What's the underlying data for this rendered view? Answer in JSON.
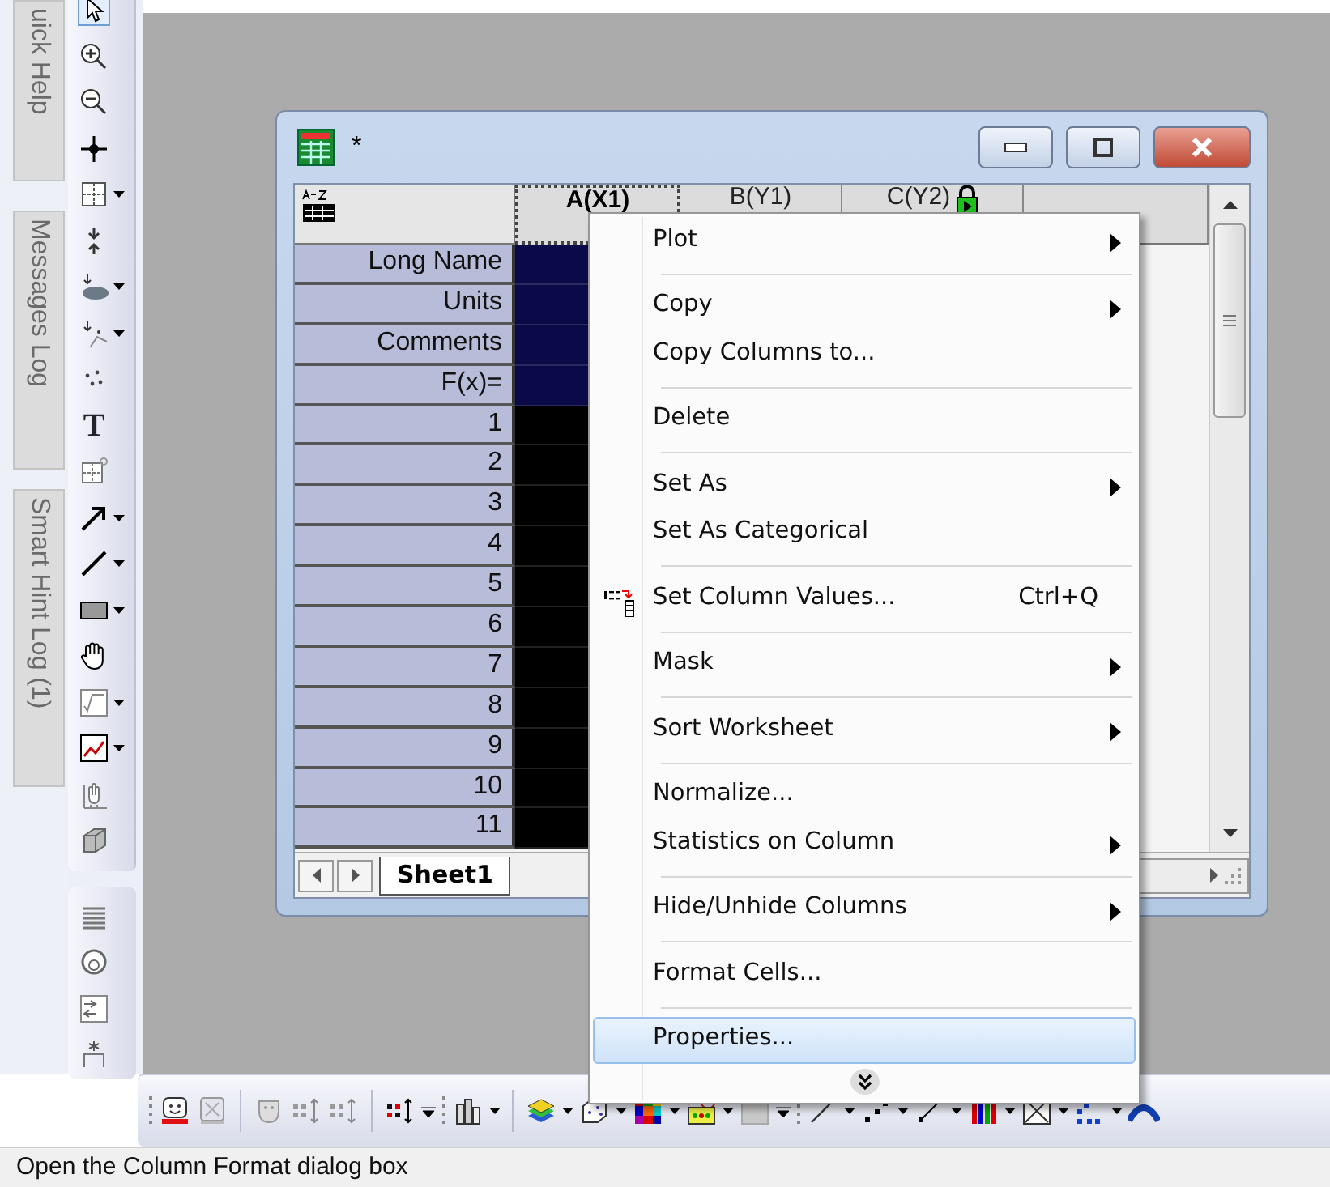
{
  "side_panels": [
    {
      "label": "uick Help"
    },
    {
      "label": "Messages Log"
    },
    {
      "label": "Smart Hint Log (1)"
    }
  ],
  "left_toolbar": {
    "text_tool": "T"
  },
  "worksheet": {
    "title": "*",
    "columns": [
      {
        "label": "A(X1)",
        "selected": true,
        "locked": false
      },
      {
        "label": "B(Y1)",
        "selected": false,
        "locked": false
      },
      {
        "label": "C(Y2)",
        "selected": false,
        "locked": true
      }
    ],
    "row_labels": [
      "Long Name",
      "Units",
      "Comments",
      "F(x)=",
      "1",
      "2",
      "3",
      "4",
      "5",
      "6",
      "7",
      "8",
      "9",
      "10",
      "11"
    ],
    "sheet_tabs": [
      {
        "label": "Sheet1",
        "selected": true
      }
    ]
  },
  "context_menu": {
    "groups": [
      [
        {
          "label": "Plot",
          "submenu": true,
          "selected": false
        }
      ],
      [
        {
          "label": "Copy",
          "submenu": true,
          "selected": false
        },
        {
          "label": "Copy Columns to...",
          "submenu": false,
          "selected": false
        }
      ],
      [
        {
          "label": "Delete",
          "submenu": false,
          "selected": false
        }
      ],
      [
        {
          "label": "Set As",
          "submenu": true,
          "selected": false
        },
        {
          "label": "Set As Categorical",
          "submenu": false,
          "selected": false
        }
      ],
      [
        {
          "label": "Set Column Values...",
          "submenu": false,
          "selected": false,
          "shortcut": "Ctrl+Q",
          "has_icon": true
        }
      ],
      [
        {
          "label": "Mask",
          "submenu": true,
          "selected": false
        }
      ],
      [
        {
          "label": "Sort Worksheet",
          "submenu": true,
          "selected": false
        }
      ],
      [
        {
          "label": "Normalize...",
          "submenu": false,
          "selected": false
        },
        {
          "label": "Statistics on Column",
          "submenu": true,
          "selected": false
        }
      ],
      [
        {
          "label": "Hide/Unhide Columns",
          "submenu": true,
          "selected": false
        }
      ],
      [
        {
          "label": "Format Cells...",
          "submenu": false,
          "selected": false
        }
      ],
      [
        {
          "label": "Properties...",
          "submenu": false,
          "selected": true
        }
      ]
    ]
  },
  "status_bar": {
    "text": "Open the Column Format dialog box"
  }
}
